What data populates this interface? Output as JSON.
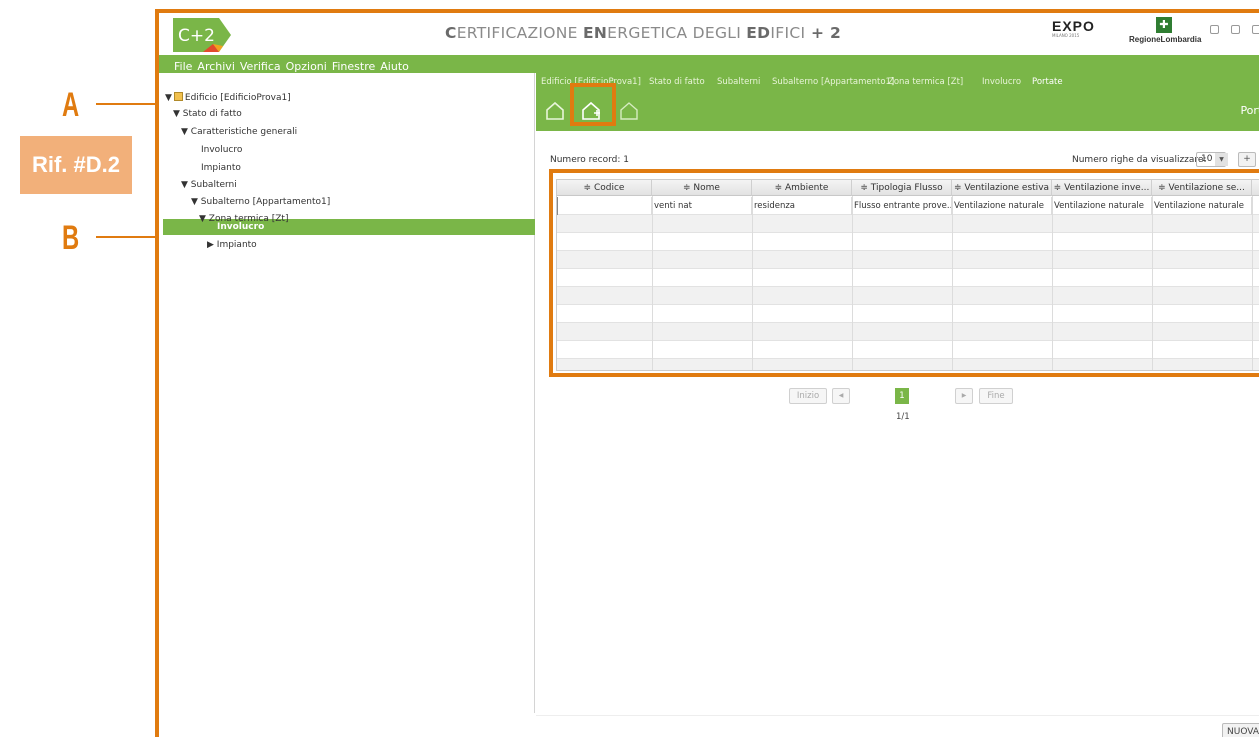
{
  "annotations": {
    "label_a": "A",
    "label_b": "B",
    "ref_box": "Rif. #D.2",
    "accent_color": "#e07b10"
  },
  "app": {
    "logo_text": "C+2",
    "title_parts": [
      "C",
      "ERTIFICAZIONE ",
      "EN",
      "ERGETICA DEGLI ",
      "ED",
      "IFICI",
      " + 2"
    ],
    "expo_text": "EXPO",
    "expo_sub": "MILANO 2015",
    "regione_text": "RegioneLombardia",
    "brand_color": "#7ab648"
  },
  "menu": {
    "items": [
      "File",
      "Archivi",
      "Verifica",
      "Opzioni",
      "Finestre",
      "Aiuto"
    ]
  },
  "tree": {
    "items": [
      {
        "label": "Edificio [EdificioProva1]",
        "prefix": "▼"
      },
      {
        "label": "Stato di fatto",
        "prefix": "▼"
      },
      {
        "label": "Caratteristiche generali",
        "prefix": "▼"
      },
      {
        "label": "Involucro",
        "prefix": ""
      },
      {
        "label": "Impianto",
        "prefix": ""
      },
      {
        "label": "Subalterni",
        "prefix": "▼"
      },
      {
        "label": "Subalterno [Appartamento1]",
        "prefix": "▼"
      },
      {
        "label": "Zona termica [Zt]",
        "prefix": "▼"
      },
      {
        "label": "Involucro",
        "prefix": ""
      },
      {
        "label": "Impianto",
        "prefix": "▶"
      }
    ]
  },
  "breadcrumb": {
    "items": [
      "Edificio [EdificioProva1]",
      "Stato di fatto",
      "Subalterni",
      "Subalterno [Appartamento1]",
      "Zona termica [Zt]",
      "Involucro",
      "Portate"
    ]
  },
  "toolbar": {
    "section_label": "Porta"
  },
  "records": {
    "count_label": "Numero record: 1",
    "rows_label": "Numero righe da visualizzare:",
    "rows_value": "10",
    "plus_label": "+"
  },
  "table": {
    "headers": [
      "≑ Codice",
      "≑ Nome",
      "≑ Ambiente",
      "≑ Tipologia Flusso",
      "≑ Ventilazione estiva",
      "≑ Ventilazione inve...",
      "≑ Ventilazione se..."
    ],
    "rows": [
      [
        "",
        "venti nat",
        "residenza",
        "Flusso entrante prove...",
        "Ventilazione naturale",
        "Ventilazione naturale",
        "Ventilazione naturale"
      ]
    ]
  },
  "pager": {
    "first": "Inizio",
    "prev": "◀",
    "current": "1",
    "next": "▶",
    "last": "Fine",
    "page_info": "1/1"
  },
  "footer": {
    "new_button": "NUOVA"
  }
}
